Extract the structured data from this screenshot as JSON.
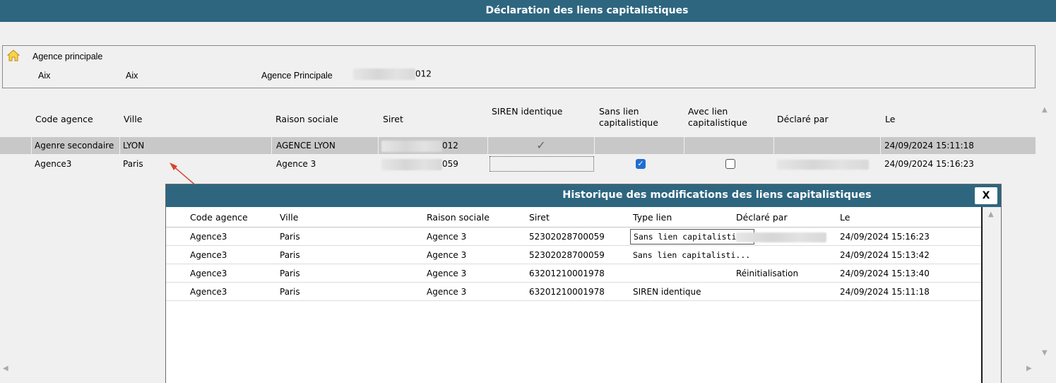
{
  "window": {
    "title": "Déclaration des liens capitalistiques"
  },
  "agency": {
    "title": "Agence principale",
    "code": "Aix",
    "city": "Aix",
    "name": "Agence Principale",
    "siret_suffix": "012",
    "icon": "home-icon"
  },
  "grid": {
    "columns": [
      "Code agence",
      "Ville",
      "Raison sociale",
      "Siret",
      "SIREN identique",
      "Sans lien capitalistique",
      "Avec lien capitalistique",
      "Déclaré par",
      "Le"
    ],
    "rows": [
      {
        "code": "Agenre secondaire",
        "ville": "LYON",
        "raison": "AGENCE LYON",
        "siret_suffix": "012",
        "siren_identique": "✓",
        "sans_lien": false,
        "avec_lien": false,
        "date": "24/09/2024 15:11:18",
        "selected": true
      },
      {
        "code": "Agence3",
        "ville": "Paris",
        "raison": "Agence 3",
        "siret_suffix": "059",
        "siren_identique": "",
        "sans_lien": true,
        "avec_lien": false,
        "date": "24/09/2024 15:16:23",
        "selected": false
      }
    ],
    "check_glyph": "✓"
  },
  "history": {
    "title": "Historique des modifications des liens capitalistiques",
    "close_label": "X",
    "columns": [
      "Code agence",
      "Ville",
      "Raison sociale",
      "Siret",
      "Type lien",
      "Déclaré par",
      "Le"
    ],
    "rows": [
      {
        "code": "Agence3",
        "ville": "Paris",
        "raison": "Agence 3",
        "siret": "52302028700059",
        "type": "Sans lien capitalisti...",
        "declare": "",
        "date": "24/09/2024 15:16:23"
      },
      {
        "code": "Agence3",
        "ville": "Paris",
        "raison": "Agence 3",
        "siret": "52302028700059",
        "type": "Sans lien capitalisti...",
        "declare": "",
        "date": "24/09/2024 15:13:42"
      },
      {
        "code": "Agence3",
        "ville": "Paris",
        "raison": "Agence 3",
        "siret": "63201210001978",
        "type": "",
        "declare": "Réinitialisation",
        "date": "24/09/2024 15:13:40"
      },
      {
        "code": "Agence3",
        "ville": "Paris",
        "raison": "Agence 3",
        "siret": "63201210001978",
        "type": "SIREN identique",
        "declare": "",
        "date": "24/09/2024 15:11:18"
      }
    ]
  },
  "colors": {
    "title_bar": "#2e6680",
    "accent_checkbox": "#1f6fd1",
    "annotation_arrow": "#d9412b"
  }
}
